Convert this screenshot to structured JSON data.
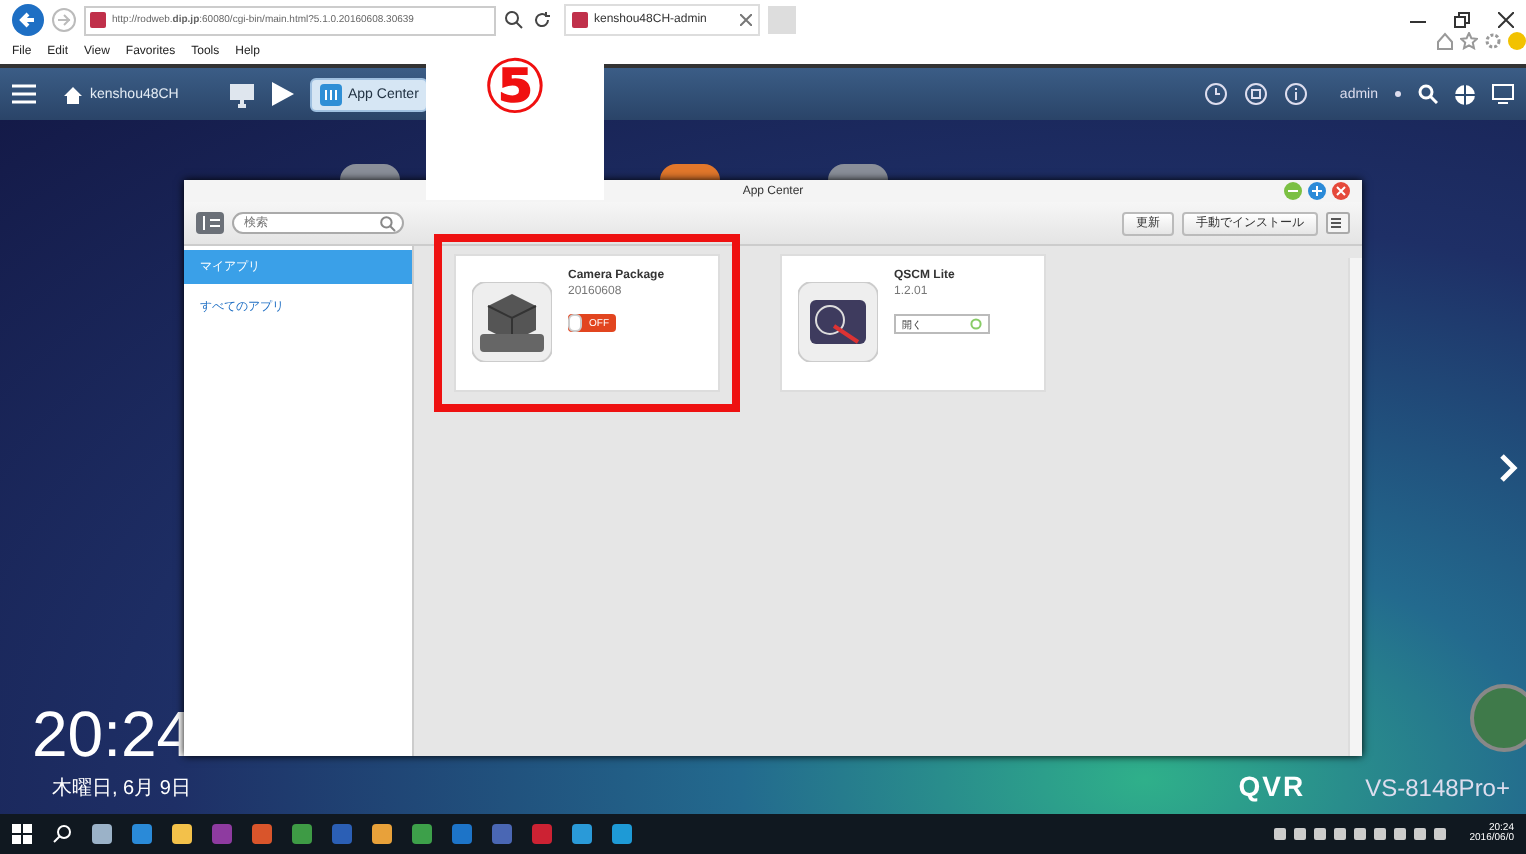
{
  "browser": {
    "address": "http://rodweb.**dip.jp**:60080/cgi-bin/main.html?5.1.0.20160608.30639",
    "tab_title": "kenshou48CH-admin",
    "menu": [
      "File",
      "Edit",
      "View",
      "Favorites",
      "Tools",
      "Help"
    ]
  },
  "nas_toolbar": {
    "device": "kenshou48CH",
    "app_tab": "App Center",
    "user": "admin"
  },
  "step_marker": "⑤",
  "app_center": {
    "title": "App Center",
    "search": {
      "placeholder": "検索"
    },
    "buttons": [
      "更新",
      "手動でインストール"
    ],
    "sidebar": [
      {
        "label": "マイアプリ",
        "selected": true
      },
      {
        "label": "すべてのアプリ",
        "selected": false
      }
    ],
    "apps": [
      {
        "name": "Camera Package",
        "version": "20160608",
        "kind": "toggle",
        "on": false,
        "control": "OFF",
        "highlighted": true
      },
      {
        "name": "QSCM Lite",
        "version": "1.2.01",
        "kind": "open",
        "control": "開く",
        "highlighted": false
      }
    ]
  },
  "desktop": {
    "time": "20:24",
    "date": "木曜日, 6月 9日",
    "brand": "QVR",
    "model": "VS-8148Pro+"
  },
  "taskbar": {
    "time": "20:24",
    "date": "2016/06/0"
  }
}
